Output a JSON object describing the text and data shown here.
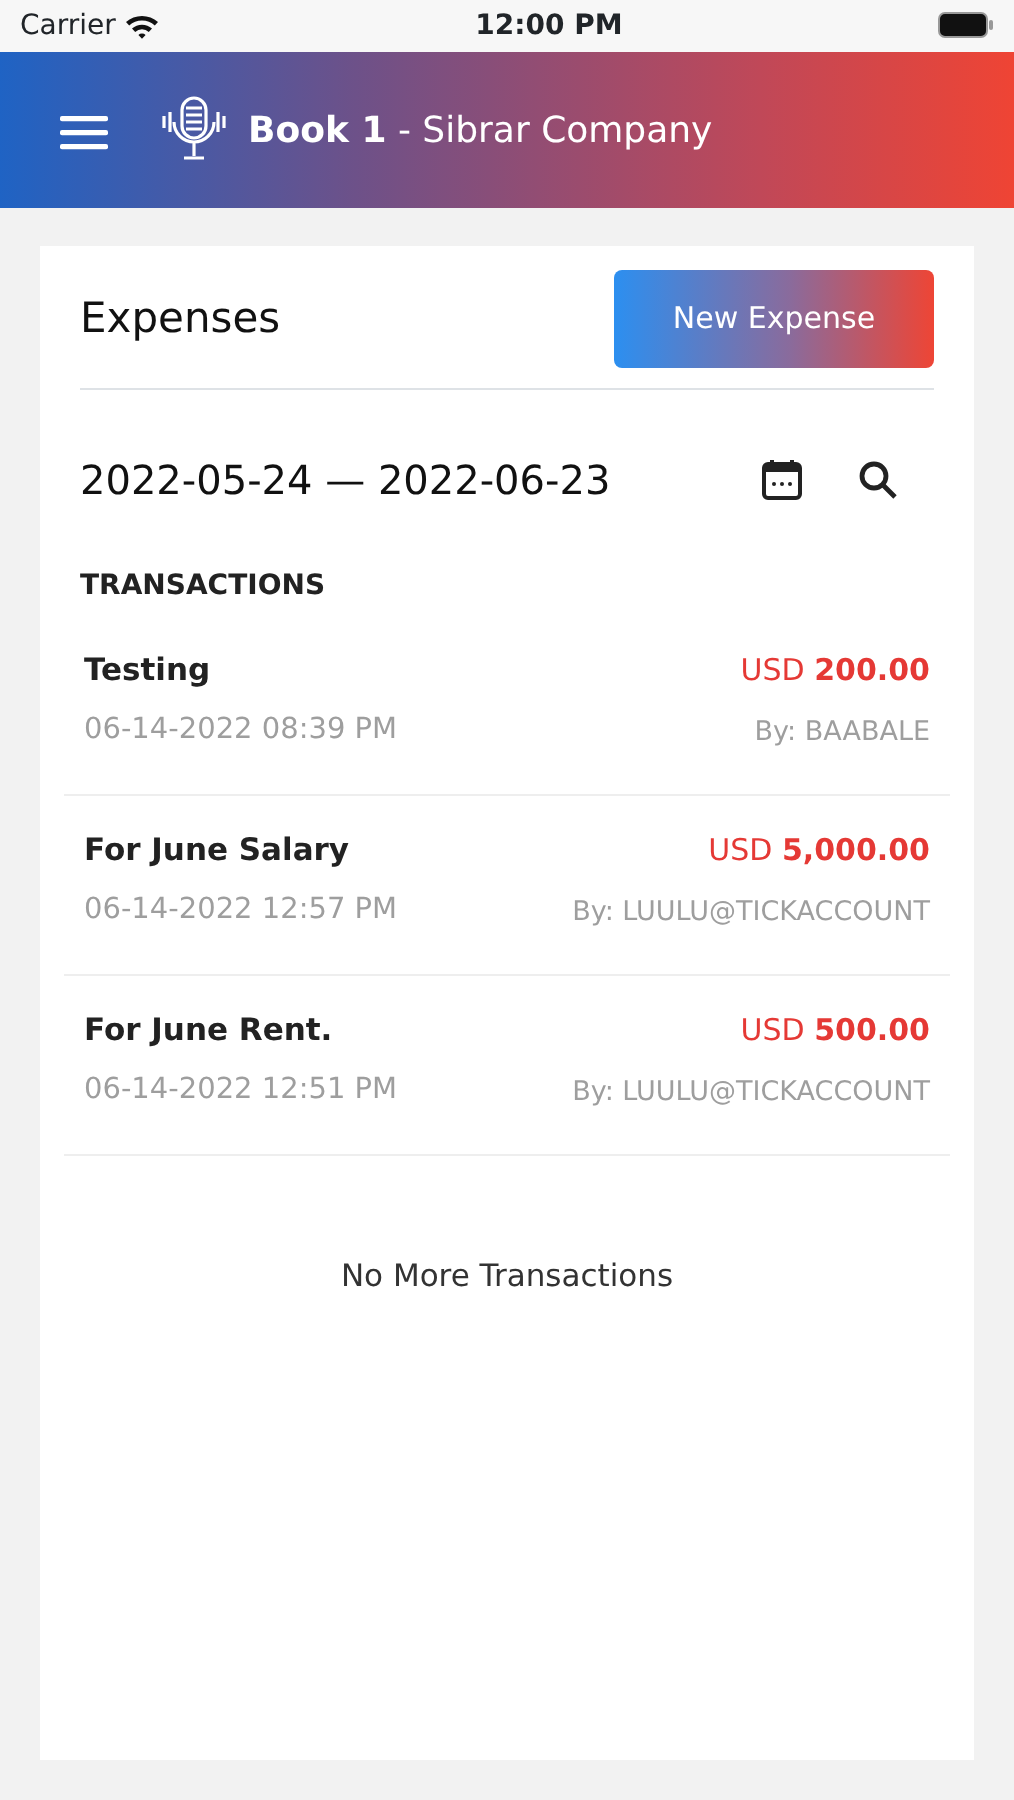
{
  "status_bar": {
    "carrier": "Carrier",
    "time": "12:00 PM"
  },
  "header": {
    "title": "**Book 1** - Sibrar Company"
  },
  "page": {
    "title": "Expenses",
    "new_button": "New Expense",
    "date_range": "2022-05-24 — 2022-06-23",
    "section": "TRANSACTIONS"
  },
  "transactions": [
    {
      "title": "Testing",
      "amount": "USD **200.00**",
      "date": "06-14-2022 08:39 PM",
      "by": "By: BAABALE"
    },
    {
      "title": "For June Salary",
      "amount": "USD **5,000.00**",
      "date": "06-14-2022 12:57 PM",
      "by": "By: LUULU@TICKACCOUNT"
    },
    {
      "title": "For June Rent.",
      "amount": "USD **500.00**",
      "date": "06-14-2022 12:51 PM",
      "by": "By: LUULU@TICKACCOUNT"
    }
  ],
  "footer_note": "No More Transactions"
}
